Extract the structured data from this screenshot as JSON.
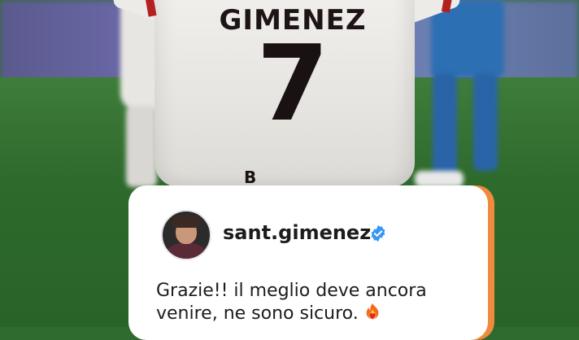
{
  "shirt": {
    "name": "GIMENEZ",
    "number": "7",
    "sponsor": "B"
  },
  "comment": {
    "username": "sant.gimenez",
    "verified_icon": "verified-badge-icon",
    "message": "Grazie!! il meglio deve ancora venire, ne sono sicuro.",
    "emoji_icon": "fire-heart-icon"
  },
  "colors": {
    "verified": "#3897f0",
    "accent": "#f08a3c",
    "card_bg": "#ffffff"
  }
}
